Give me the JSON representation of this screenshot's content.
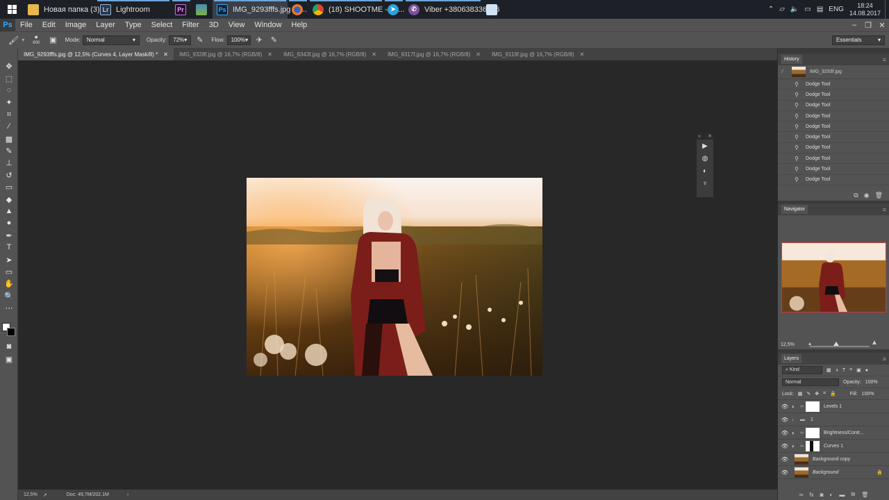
{
  "taskbar": {
    "items": [
      {
        "label": "Новая папка (3)",
        "icon": "folder-icon"
      },
      {
        "label": "Lightroom",
        "icon": "lightroom-icon"
      },
      {
        "label": "",
        "icon": "premiere-icon"
      },
      {
        "label": "",
        "icon": "photo-viewer-icon"
      },
      {
        "label": "IMG_9293fffs.jpg @...",
        "icon": "photoshop-icon"
      },
      {
        "label": "",
        "icon": "firefox-icon"
      },
      {
        "label": "(18) SHOOTME - Yo...",
        "icon": "chrome-icon"
      },
      {
        "label": "",
        "icon": "telegram-icon"
      },
      {
        "label": "Viber +380638336126",
        "icon": "viber-icon"
      },
      {
        "label": "",
        "icon": "notepad-icon"
      }
    ],
    "tray": {
      "language": "ENG",
      "time": "18:24",
      "date": "14.08.2017"
    }
  },
  "menubar": {
    "app_logo": "Ps",
    "items": [
      "File",
      "Edit",
      "Image",
      "Layer",
      "Type",
      "Select",
      "Filter",
      "3D",
      "View",
      "Window",
      "Help"
    ]
  },
  "options": {
    "brush_size": "600",
    "mode_label": "Mode:",
    "mode_value": "Normal",
    "opacity_label": "Opacity:",
    "opacity_value": "72%",
    "flow_label": "Flow:",
    "flow_value": "100%",
    "workspace": "Essentials"
  },
  "tabs": [
    {
      "label": "IMG_9293fffs.jpg @ 12,5% (Curves 4, Layer Mask/8) *",
      "active": true
    },
    {
      "label": "IMG_9328f.jpg @ 16,7% (RGB/8)",
      "active": false
    },
    {
      "label": "IMG_9343f.jpg @ 16,7% (RGB/8)",
      "active": false
    },
    {
      "label": "IMG_9317f.jpg @ 16,7% (RGB/8)",
      "active": false
    },
    {
      "label": "IMG_9119f.jpg @ 16,7% (RGB/8)",
      "active": false
    }
  ],
  "statusbar": {
    "zoom": "12,5%",
    "doc": "Doc: 49,7M/202,1M"
  },
  "history": {
    "title": "History",
    "snapshot": "IMG_9293f.jpg",
    "steps": [
      "Dodge Tool",
      "Dodge Tool",
      "Dodge Tool",
      "Dodge Tool",
      "Dodge Tool",
      "Dodge Tool",
      "Dodge Tool",
      "Dodge Tool",
      "Dodge Tool",
      "Dodge Tool"
    ]
  },
  "navigator": {
    "title": "Navigator",
    "zoom": "12,5%"
  },
  "layers": {
    "title": "Layers",
    "filter": "Kind",
    "blend": "Normal",
    "opacity_label": "Opacity:",
    "opacity": "100%",
    "lock_label": "Lock:",
    "fill_label": "Fill:",
    "fill": "100%",
    "items": [
      {
        "name": "Levels 1",
        "type": "adjustment",
        "mask": "white"
      },
      {
        "name": "1",
        "type": "group",
        "mask": "none"
      },
      {
        "name": "Brightness/Contr...",
        "type": "adjustment",
        "mask": "white"
      },
      {
        "name": "Curves 1",
        "type": "adjustment",
        "mask": "curves"
      },
      {
        "name": "Background copy",
        "type": "photo",
        "mask": "none"
      },
      {
        "name": "Background",
        "type": "photo",
        "mask": "none"
      }
    ]
  },
  "colors": {
    "ps_blue": "#31a8ff",
    "nav_frame": "#d03a3a"
  }
}
